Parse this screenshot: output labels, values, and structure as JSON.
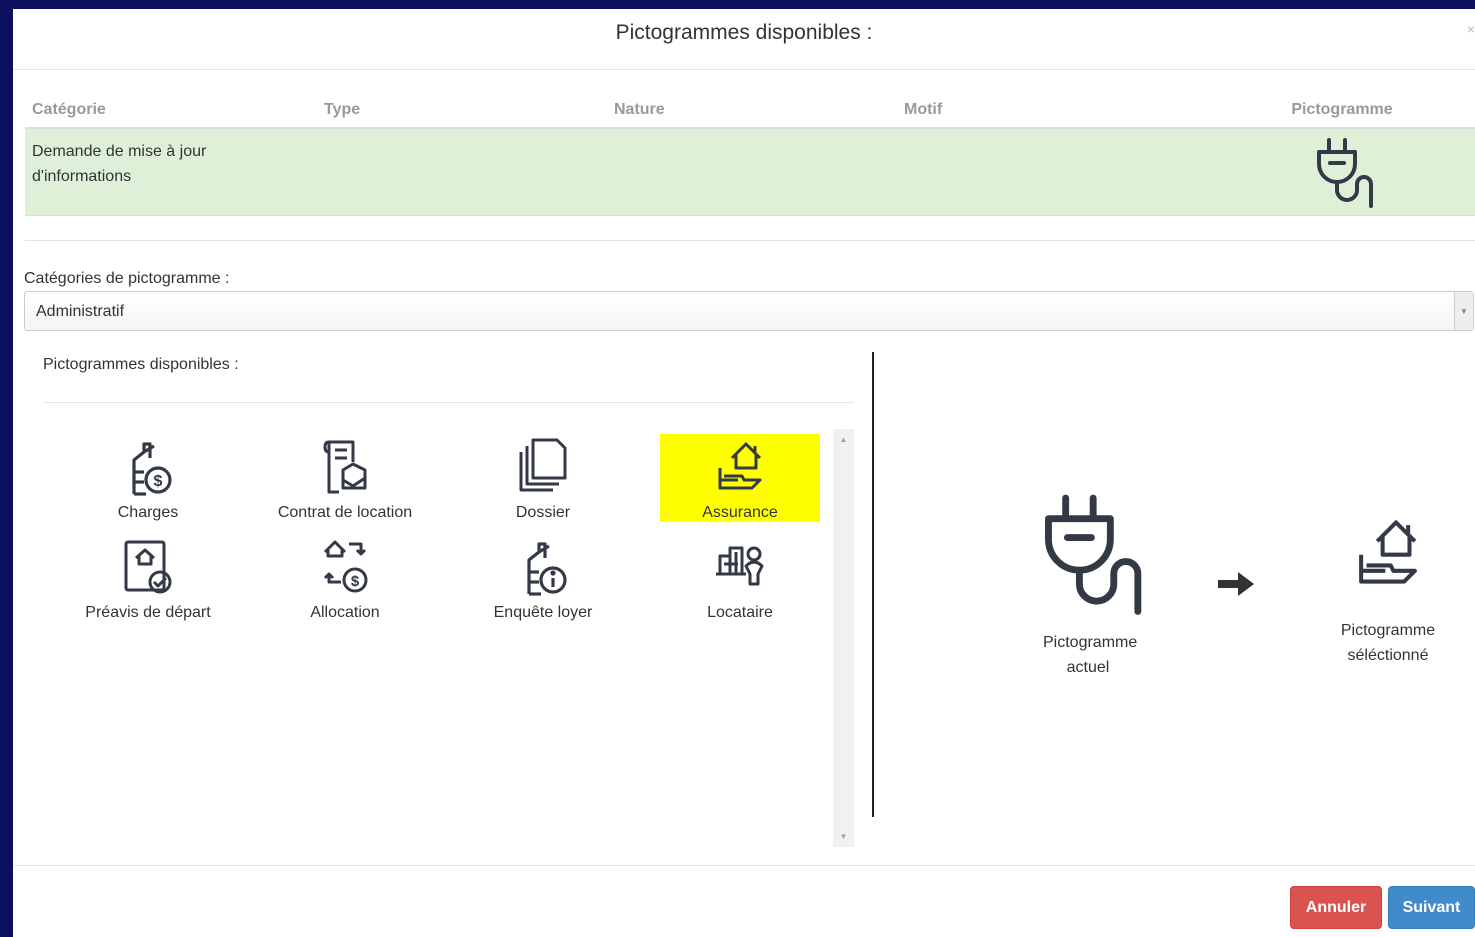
{
  "modal": {
    "title": "Pictogrammes disponibles :",
    "close_glyph": "×"
  },
  "table": {
    "headers": [
      "Catégorie",
      "Type",
      "Nature",
      "Motif",
      "Pictogramme"
    ],
    "row": {
      "categorie": "Demande de mise à jour d'informations",
      "type": "",
      "nature": "",
      "motif": "",
      "pictogramme_icon": "plug-icon"
    }
  },
  "category_select": {
    "label": "Catégories de pictogramme :",
    "value": "Administratif"
  },
  "available": {
    "label": "Pictogrammes disponibles :",
    "items": [
      {
        "label": "Charges",
        "icon": "charges-icon",
        "selected": false
      },
      {
        "label": "Contrat de location",
        "icon": "contract-icon",
        "selected": false
      },
      {
        "label": "Dossier",
        "icon": "folder-icon",
        "selected": false
      },
      {
        "label": "Assurance",
        "icon": "insurance-icon",
        "selected": true
      },
      {
        "label": "Préavis de départ",
        "icon": "notice-icon",
        "selected": false
      },
      {
        "label": "Allocation",
        "icon": "allocation-icon",
        "selected": false
      },
      {
        "label": "Enquête loyer",
        "icon": "survey-icon",
        "selected": false
      },
      {
        "label": "Locataire",
        "icon": "tenant-icon",
        "selected": false
      }
    ],
    "highlight_color": "#ffff00"
  },
  "preview": {
    "current_label": "Pictogramme actuel",
    "selected_label": "Pictogramme séléctionné"
  },
  "buttons": {
    "cancel": "Annuler",
    "next": "Suivant"
  },
  "colors": {
    "cancel": "#d9534f",
    "next": "#428bca",
    "row_bg": "#dff0d8",
    "backdrop": "#0b0f5c"
  }
}
